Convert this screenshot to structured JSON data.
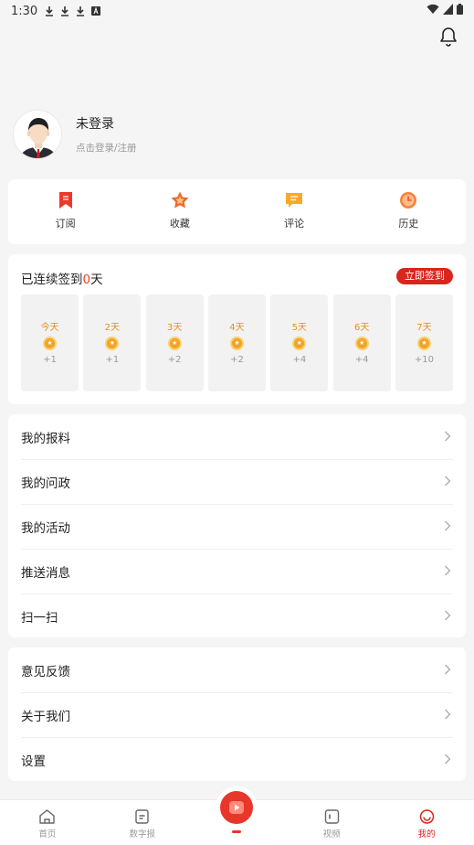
{
  "status_bar": {
    "time": "1:30"
  },
  "profile": {
    "name": "未登录",
    "subtitle": "点击登录/注册"
  },
  "quick_actions": [
    {
      "label": "订阅",
      "icon": "bookmark-icon"
    },
    {
      "label": "收藏",
      "icon": "star-icon"
    },
    {
      "label": "评论",
      "icon": "comment-icon"
    },
    {
      "label": "历史",
      "icon": "clock-icon"
    }
  ],
  "checkin": {
    "title_prefix": "已连续签到",
    "count": "0",
    "title_suffix": "天",
    "button": "立即签到",
    "days": [
      {
        "label": "今天",
        "points": "+1"
      },
      {
        "label": "2天",
        "points": "+1"
      },
      {
        "label": "3天",
        "points": "+2"
      },
      {
        "label": "4天",
        "points": "+2"
      },
      {
        "label": "5天",
        "points": "+4"
      },
      {
        "label": "6天",
        "points": "+4"
      },
      {
        "label": "7天",
        "points": "+10"
      }
    ]
  },
  "menu_group_1": [
    "我的报料",
    "我的问政",
    "我的活动",
    "推送消息",
    "扫一扫"
  ],
  "menu_group_2": [
    "意见反馈",
    "关于我们",
    "设置"
  ],
  "tabbar": {
    "tabs": [
      {
        "label": "首页",
        "icon": "home-icon"
      },
      {
        "label": "数字报",
        "icon": "newspaper-icon"
      },
      {
        "label": "视频",
        "icon": "video-icon"
      },
      {
        "label": "我的",
        "icon": "profile-icon"
      }
    ],
    "active": "我的"
  },
  "colors": {
    "accent": "#d8261c",
    "coin": "#f0a32a",
    "day_label": "#e6901e",
    "quick_icon": "#f0682a"
  }
}
